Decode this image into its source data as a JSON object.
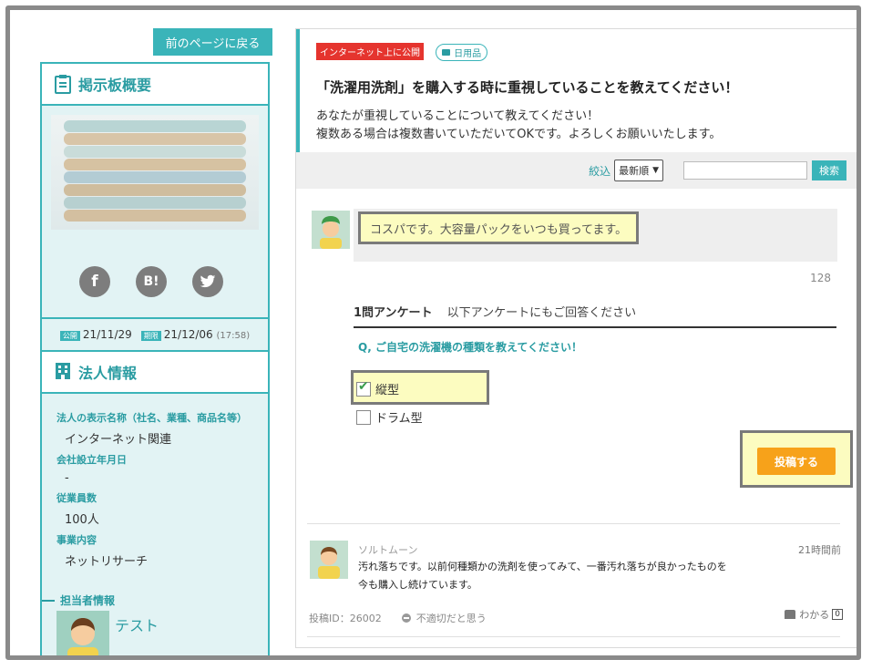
{
  "nav": {
    "back_label": "前のページに戻る"
  },
  "sidebar": {
    "overview_title": "掲示板概要",
    "published_badge": "公開",
    "published_date": "21/11/29",
    "deadline_badge": "期限",
    "deadline_date": "21/12/06",
    "deadline_time": "(17:58)",
    "corp_title": "法人情報",
    "corp_fields": [
      {
        "label": "法人の表示名称（社名、業種、商品名等）",
        "value": "インターネット関連"
      },
      {
        "label": "会社設立年月日",
        "value": "-"
      },
      {
        "label": "従業員数",
        "value": "100人"
      },
      {
        "label": "事業内容",
        "value": "ネットリサーチ"
      }
    ],
    "contact_title": "担当者情報",
    "contact_name": "テスト",
    "social_icons": [
      "facebook-icon",
      "hatena-bookmark-icon",
      "twitter-icon"
    ],
    "social_labels": {
      "facebook": "f",
      "hatena": "B!"
    }
  },
  "question": {
    "visibility_badge": "インターネット上に公開",
    "category": "日用品",
    "title": "「洗濯用洗剤」を購入する時に重視していることを教えてください！",
    "desc_line1": "あなたが重視していることについて教えてください！",
    "desc_line2": "複数ある場合は複数書いていただいてOKです。よろしくお願いいたします。"
  },
  "filter": {
    "label": "絞込",
    "sort_selected": "最新順",
    "search_value": "",
    "search_button": "検索"
  },
  "compose": {
    "comment_text": "コスパです。大容量パックをいつも買ってます。",
    "char_count": "128",
    "survey_title": "1問アンケート",
    "survey_note": "以下アンケートにもご回答ください",
    "survey_question": "Q, ご自宅の洗濯機の種類を教えてください！",
    "options": [
      {
        "label": "縦型",
        "checked": true
      },
      {
        "label": "ドラム型",
        "checked": false
      }
    ],
    "post_button": "投稿する"
  },
  "answer": {
    "name": "ソルトムーン",
    "time": "21時間前",
    "text_line1": "汚れ落ちです。以前何種類かの洗剤を使ってみて、一番汚れ落ちが良かったものを",
    "text_line2": "今も購入し続けています。",
    "post_id": "投稿ID：26002",
    "report_label": "不適切だと思う",
    "like_label": "わかる",
    "like_count": "0"
  },
  "colors": {
    "accent": "#3ab4b9",
    "post": "#f7a21a",
    "badge_red": "#e5342e",
    "highlight": "#fcfcc0"
  }
}
